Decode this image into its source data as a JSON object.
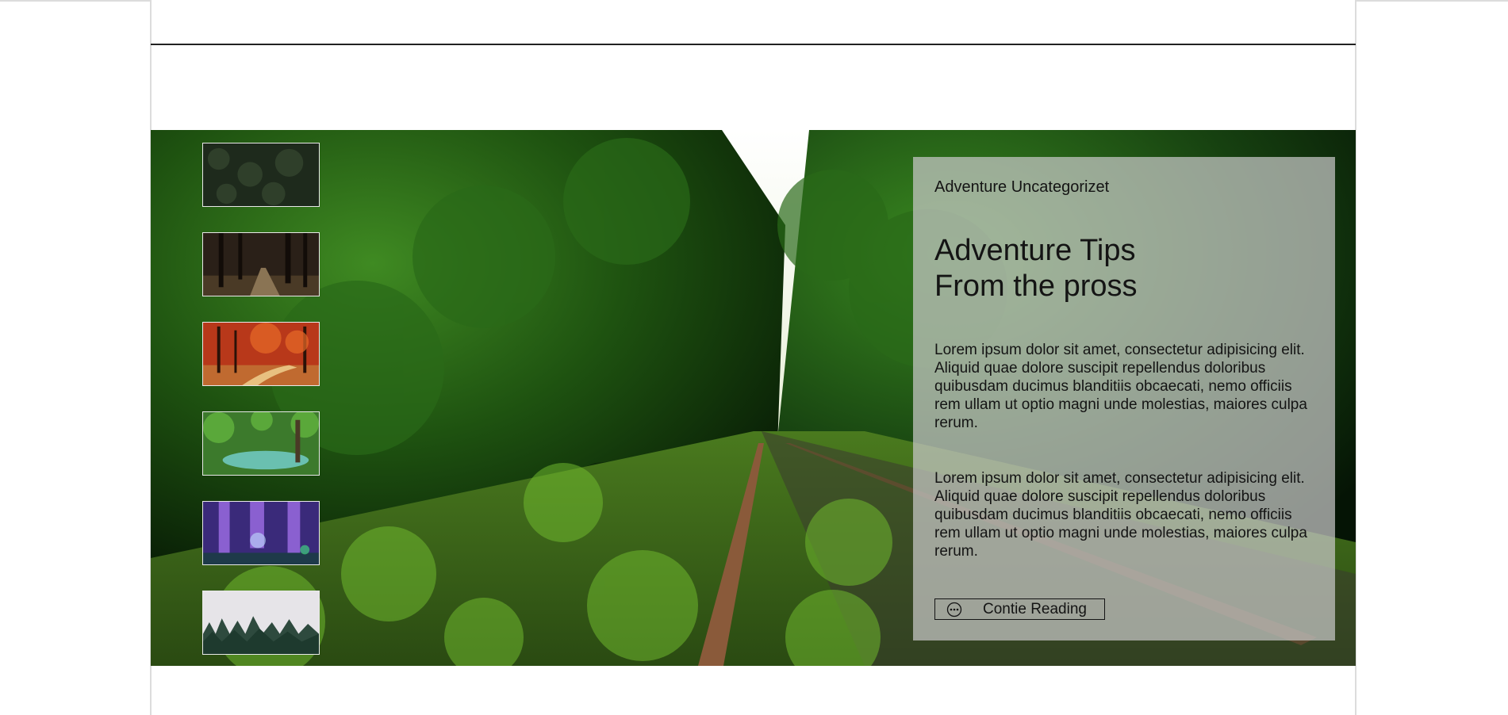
{
  "post": {
    "categories": "Adventure Uncategorizet",
    "title_line1": "Adventure Tips",
    "title_line2": "From the pross",
    "paragraphs": [
      "Lorem ipsum dolor sit amet, consectetur adipisicing elit. Aliquid quae dolore suscipit repellendus doloribus quibusdam ducimus blanditiis obcaecati, nemo officiis rem ullam ut optio magni unde molestias, maiores culpa rerum.",
      "Lorem ipsum dolor sit amet, consectetur adipisicing elit. Aliquid quae dolore suscipit repellendus doloribus quibusdam ducimus blanditiis obcaecati, nemo officiis rem ullam ut optio magni unde molestias, maiores culpa rerum."
    ],
    "read_more_label": "Contie Reading",
    "read_more_icon": "ellipsis-circle-icon"
  },
  "thumbnails": [
    {
      "name": "thumb-pine-forest-aerial",
      "colors": [
        "#1e2a1c",
        "#2f3f2a"
      ]
    },
    {
      "name": "thumb-dark-forest-path",
      "colors": [
        "#2a2018",
        "#6b5a40"
      ]
    },
    {
      "name": "thumb-autumn-forest",
      "colors": [
        "#b8381a",
        "#e8a040"
      ]
    },
    {
      "name": "thumb-jungle-river",
      "colors": [
        "#3c7a2c",
        "#6ac0b0"
      ]
    },
    {
      "name": "thumb-purple-fantasy-forest",
      "colors": [
        "#3a2a7a",
        "#8a60d0"
      ]
    },
    {
      "name": "thumb-misty-pine-forest",
      "colors": [
        "#e6e4e8",
        "#2e4a3e"
      ]
    }
  ],
  "colors": {
    "card_bg": "rgba(200,200,200,0.72)",
    "text": "#141414",
    "foliage_dark": "#0e2a0a",
    "foliage_light": "#5aa02a",
    "rail": "#8a5a3a"
  }
}
